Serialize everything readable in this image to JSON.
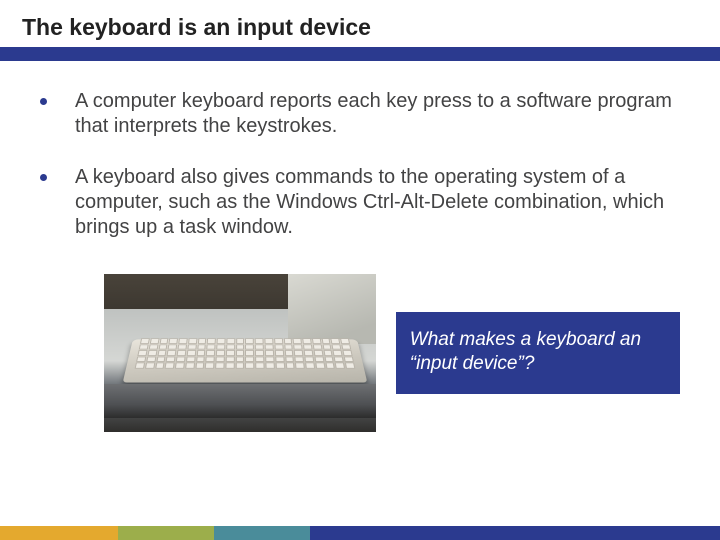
{
  "title": "The keyboard is an input device",
  "bullets": [
    "A computer keyboard reports each key press to a software program that interprets the keystrokes.",
    "A keyboard also gives commands to the operating system of a computer, such as the Windows Ctrl-Alt-Delete combination, which brings up a task window."
  ],
  "callout": "What makes a keyboard an “input device”?",
  "image_alt": "Photograph of a beige computer keyboard on a pull-out tray",
  "colors": {
    "accent": "#2b3a8f",
    "footer": [
      "#e4a92e",
      "#9cae4b",
      "#4a8c9a",
      "#2b3a8f"
    ]
  }
}
